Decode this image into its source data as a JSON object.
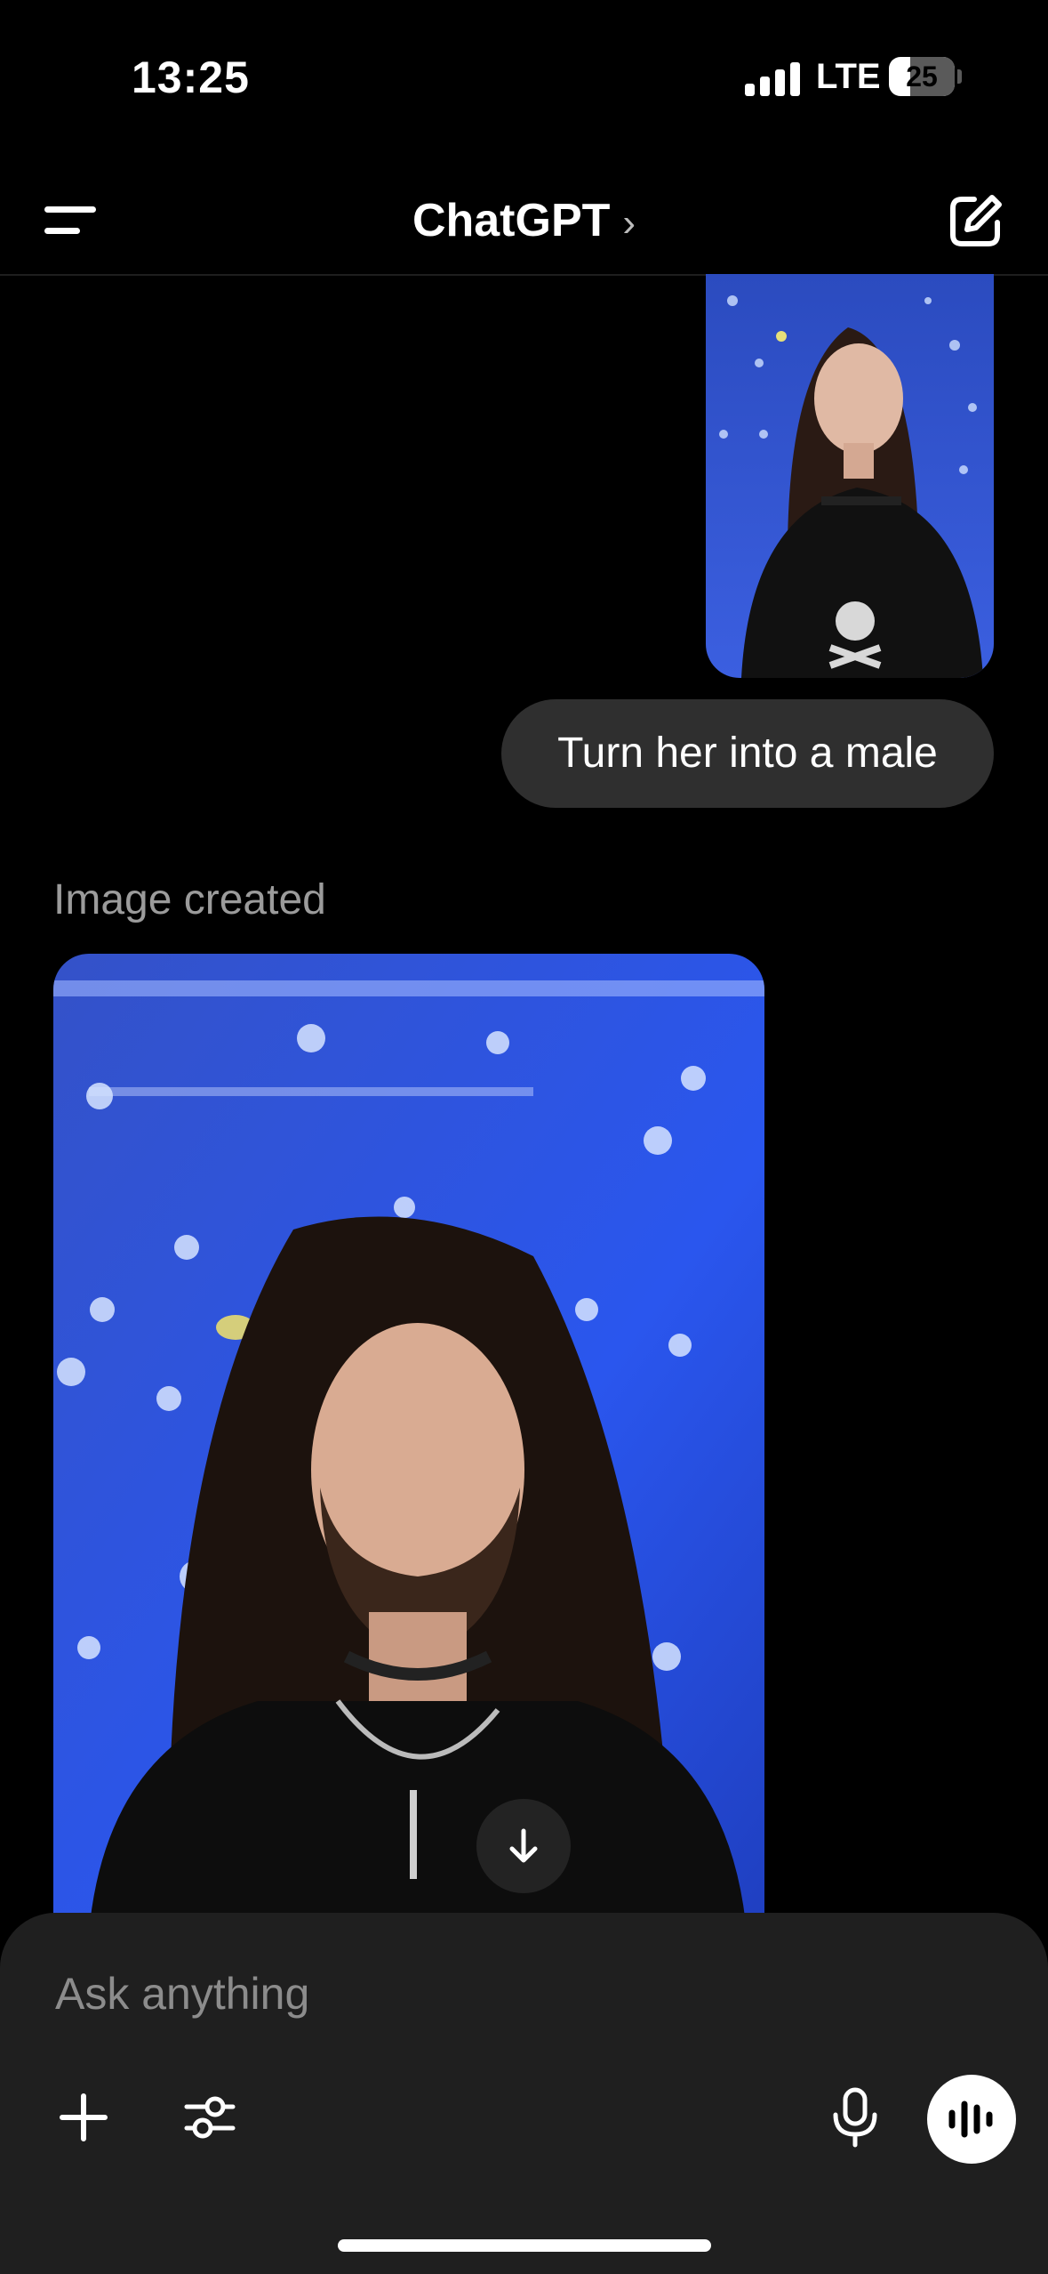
{
  "status_bar": {
    "time": "13:25",
    "network": "LTE",
    "battery": "25",
    "battery_level": 0.25
  },
  "nav": {
    "title": "ChatGPT",
    "chevron": "›",
    "menu_icon": "menu-icon",
    "new_chat_icon": "compose-icon"
  },
  "chat": {
    "user_message": "Turn her into a male",
    "assistant_status": "Image created"
  },
  "composer": {
    "placeholder": "Ask anything"
  },
  "colors": {
    "background": "#000000",
    "bubble": "#2f2f2f",
    "composer": "#1f1f1f",
    "muted_text": "#9b9b9b"
  }
}
